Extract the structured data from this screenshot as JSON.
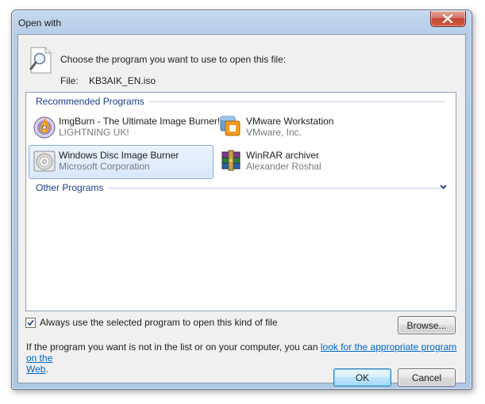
{
  "window": {
    "title": "Open with"
  },
  "header": {
    "prompt": "Choose the program you want to use to open this file:",
    "file_label": "File:",
    "file_name": "KB3AIK_EN.iso"
  },
  "groups": {
    "recommended": "Recommended Programs",
    "other": "Other Programs"
  },
  "programs": [
    {
      "name": "ImgBurn - The Ultimate Image Burner!",
      "publisher": "LIGHTNING UK!",
      "icon": "imgburn-icon"
    },
    {
      "name": "VMware Workstation",
      "publisher": "VMware, Inc.",
      "icon": "vmware-icon"
    },
    {
      "name": "Windows Disc Image Burner",
      "publisher": "Microsoft Corporation",
      "icon": "disc-burner-icon",
      "selected": true
    },
    {
      "name": "WinRAR archiver",
      "publisher": "Alexander Roshal",
      "icon": "winrar-icon"
    }
  ],
  "options": {
    "always_use_label": "Always use the selected program to open this kind of file",
    "always_use_checked": true
  },
  "buttons": {
    "browse": "Browse...",
    "ok": "OK",
    "cancel": "Cancel"
  },
  "footer": {
    "text_before": "If the program you want is not in the list or on your computer, you can ",
    "link_text_1": "look for the appropriate program on the",
    "link_text_2": "Web",
    "text_after": "."
  },
  "colors": {
    "selection_border": "#84acdd",
    "link": "#0066cc",
    "group_header": "#1e3f8c",
    "close_button": "#c24634"
  }
}
